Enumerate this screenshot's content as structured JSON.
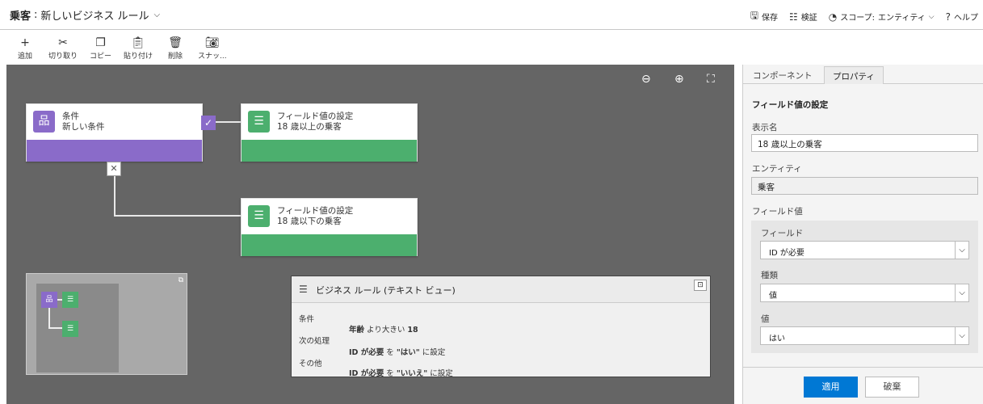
{
  "header": {
    "entity": "乗客",
    "separator": ":",
    "rule_name": "新しいビジネス ルール",
    "actions": {
      "save": "保存",
      "validate": "検証",
      "scope_label": "スコープ:",
      "scope_value": "エンティティ",
      "help": "ヘルプ"
    }
  },
  "ribbon": {
    "add": "追加",
    "cut": "切り取り",
    "copy": "コピー",
    "paste": "貼り付け",
    "delete": "削除",
    "snapshot": "スナッ..."
  },
  "canvas": {
    "condition_node": {
      "type": "条件",
      "name": "新しい条件"
    },
    "action_node_true": {
      "type": "フィールド値の設定",
      "name": "18 歳以上の乗客"
    },
    "action_node_false": {
      "type": "フィールド値の設定",
      "name": "18 歳以下の乗客"
    },
    "textview": {
      "title": "ビジネス ルール (テキスト ビュー)",
      "if_label": "条件",
      "then_label": "次の処理",
      "else_label": "その他",
      "condition_field": "年齢",
      "condition_op": "より大きい",
      "condition_value": "18",
      "then_field": "ID が必要",
      "then_mid": "を",
      "then_value": "\"はい\"",
      "then_suffix": "に設定",
      "else_field": "ID が必要",
      "else_mid": "を",
      "else_value": "\"いいえ\"",
      "else_suffix": "に設定"
    }
  },
  "panel": {
    "tabs": [
      "コンポーネント",
      "プロパティ"
    ],
    "active_tab": "プロパティ",
    "heading": "フィールド値の設定",
    "display_name_label": "表示名",
    "display_name_value": "18 歳以上の乗客",
    "entity_label": "エンティティ",
    "entity_value": "乗客",
    "field_value_label": "フィールド値",
    "field_label": "フィールド",
    "field_value": "ID が必要",
    "type_label": "種類",
    "type_value": "値",
    "value_label": "値",
    "value_value": "はい",
    "apply": "適用",
    "discard": "破棄"
  },
  "colors": {
    "condition": "#8a6bc9",
    "action": "#4caf6e",
    "canvas": "#656565",
    "primary_button": "#0078d4"
  }
}
